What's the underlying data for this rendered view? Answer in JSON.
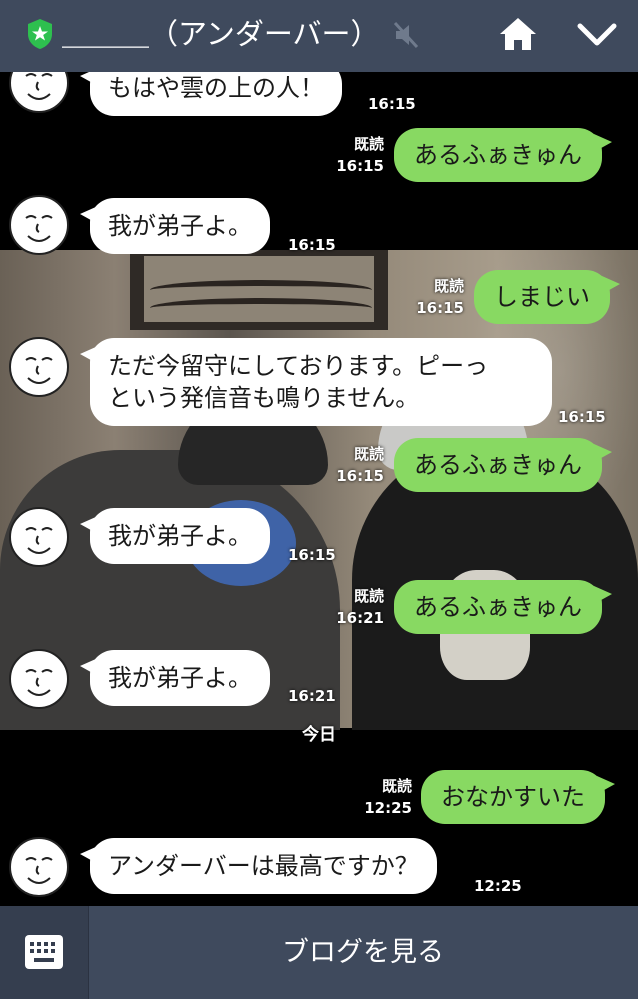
{
  "header": {
    "title": "＿＿＿（アンダーバー）",
    "icons": [
      "shield-star-icon",
      "mute-icon",
      "home-icon",
      "chevron-down-icon"
    ]
  },
  "messages": [
    {
      "side": "in",
      "text": "もはや雲の上の人！",
      "time": "16:15"
    },
    {
      "side": "out",
      "text": "あるふぁきゅん",
      "read": "既読",
      "time": "16:15"
    },
    {
      "side": "in",
      "text": "我が弟子よ。",
      "time": "16:15"
    },
    {
      "side": "out",
      "text": "しまじい",
      "read": "既読",
      "time": "16:15"
    },
    {
      "side": "in",
      "line1": "ただ今留守にしております。ピーっ",
      "line2": "という発信音も鳴りません。",
      "time": "16:15"
    },
    {
      "side": "out",
      "text": "あるふぁきゅん",
      "read": "既読",
      "time": "16:15"
    },
    {
      "side": "in",
      "text": "我が弟子よ。",
      "time": "16:15"
    },
    {
      "side": "out",
      "text": "あるふぁきゅん",
      "read": "既読",
      "time": "16:21"
    },
    {
      "side": "in",
      "text": "我が弟子よ。",
      "time": "16:21"
    },
    {
      "side": "out",
      "text": "おなかすいた",
      "read": "既読",
      "time": "12:25"
    },
    {
      "side": "in",
      "text": "アンダーバーは最高ですか？",
      "time": "12:25"
    }
  ],
  "date_separator": "今日",
  "footer": {
    "keyboard_icon": "keyboard-icon",
    "label": "ブログを見る"
  },
  "colors": {
    "header_bg": "#3f4a5d",
    "outgoing_bubble": "#88d962",
    "incoming_bubble": "#ffffff",
    "badge_green": "#2ec04f"
  }
}
